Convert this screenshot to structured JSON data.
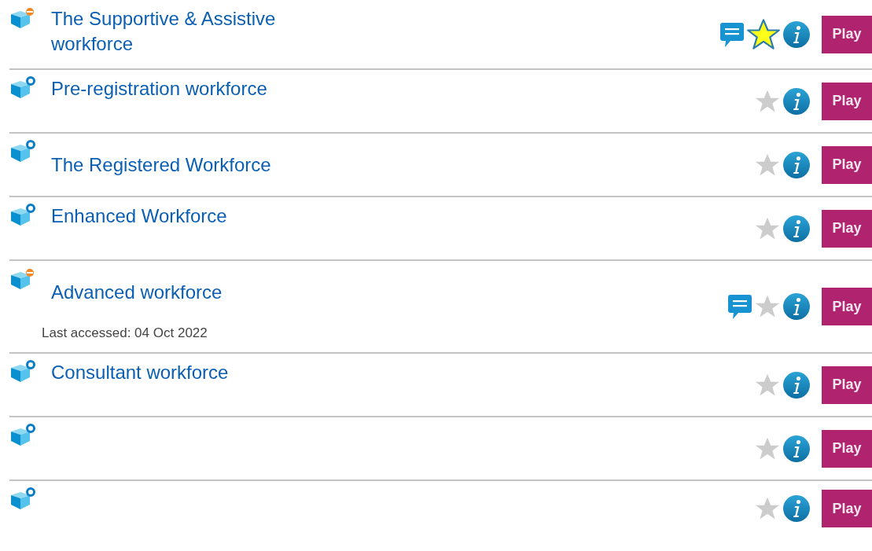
{
  "modules": [
    {
      "title": "The Supportive & Assistive workforce",
      "in_progress": true,
      "has_comments": true,
      "favourite": true,
      "play": "Play"
    },
    {
      "title": "Pre-registration workforce",
      "in_progress": false,
      "has_comments": false,
      "favourite": false,
      "play": "Play"
    },
    {
      "title": "The Registered Workforce",
      "in_progress": false,
      "has_comments": false,
      "favourite": false,
      "play": "Play"
    },
    {
      "title": "Enhanced Workforce",
      "in_progress": false,
      "has_comments": false,
      "favourite": false,
      "play": "Play"
    },
    {
      "title": "Advanced workforce",
      "in_progress": true,
      "has_comments": true,
      "favourite": false,
      "last_accessed": "Last accessed: 04 Oct 2022",
      "play": "Play"
    },
    {
      "title": "Consultant workforce",
      "in_progress": false,
      "has_comments": false,
      "favourite": false,
      "play": "Play"
    },
    {
      "in_progress": false,
      "has_comments": false,
      "favourite": false,
      "play": "Play"
    },
    {
      "in_progress": false,
      "has_comments": false,
      "favourite": false,
      "play": "Play"
    }
  ]
}
